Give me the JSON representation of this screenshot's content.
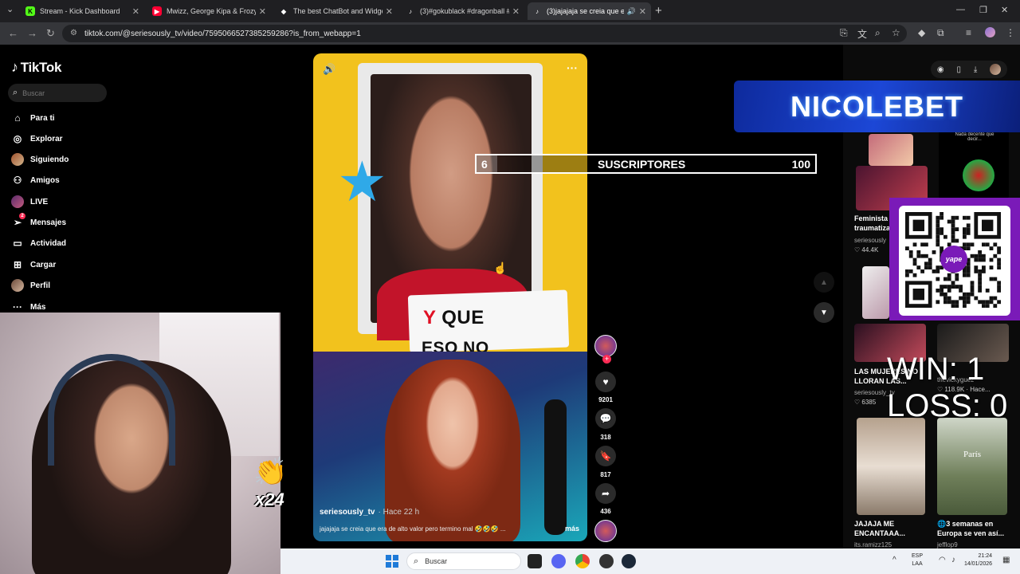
{
  "browser": {
    "tabs": [
      {
        "title": "Stream - Kick Dashboard",
        "favicon": "kick-icon",
        "color": "#53fc18",
        "active": false
      },
      {
        "title": "Mwizz, George Kipa & Frozy - D",
        "favicon": "youtube-icon",
        "color": "#ff0033",
        "active": false
      },
      {
        "title": "The best ChatBot and Widgets",
        "favicon": "botrix-icon",
        "color": "#ffffff",
        "active": false
      },
      {
        "title": "(3)#gokublack #dragonball #tra",
        "favicon": "tiktok-icon",
        "color": "#ffffff",
        "active": false
      },
      {
        "title": "(3)jajajaja se creia que era d",
        "favicon": "tiktok-icon",
        "color": "#ffffff",
        "active": true
      }
    ],
    "url": "tiktok.com/@seriesously_tv/video/7595066527385259286?is_from_webapp=1"
  },
  "tiktok": {
    "logo": "TikTok",
    "search_placeholder": "Buscar",
    "nav": [
      {
        "label": "Para ti",
        "icon": "home-icon"
      },
      {
        "label": "Explorar",
        "icon": "compass-icon"
      },
      {
        "label": "Siguiendo",
        "icon": "avatar"
      },
      {
        "label": "Amigos",
        "icon": "friends-icon"
      },
      {
        "label": "LIVE",
        "icon": "live-icon"
      },
      {
        "label": "Mensajes",
        "icon": "send-icon",
        "badge": "2"
      },
      {
        "label": "Actividad",
        "icon": "inbox-icon"
      },
      {
        "label": "Cargar",
        "icon": "upload-icon"
      },
      {
        "label": "Perfil",
        "icon": "avatar"
      },
      {
        "label": "Más",
        "icon": "more-icon"
      }
    ],
    "video": {
      "caption_line1_red": "Y",
      "caption_line1": "QUE",
      "caption_line2": "ESO NO",
      "author": "seriesously_tv",
      "time_ago": "· Hace 22 h",
      "description": "jajajaja se creia que era de alto valor pero termino mal 🤣🤣🤣 ...",
      "more": "más"
    },
    "actions": {
      "likes": "9201",
      "comments": "318",
      "saves": "817",
      "shares": "436"
    },
    "recommended": [
      {
        "title": "Feminista traumatiza...",
        "user": "seriesously",
        "stat": "♡ 44.4K"
      },
      {
        "title": "LAS MUJERES NO LLORAN LAS...",
        "user": "seriesously_tv",
        "stat": "♡ 6385"
      },
      {
        "title": "",
        "user": "thevickyguez",
        "stat": "♡ 118.9K · Hace..."
      },
      {
        "title": "JAJAJA ME ENCANTAAA...",
        "user": "its.ramizz125",
        "stat": ""
      },
      {
        "title": "🌐3 semanas en Europa se ven así...",
        "user": "jefflop9",
        "stat": ""
      }
    ],
    "thumb_text": "Nada decente que decir...",
    "thumb_paris": "París"
  },
  "overlay": {
    "sub_current": "6",
    "sub_label": "SUSCRIPTORES",
    "sub_goal": "100",
    "sub_progress": 0.06,
    "sponsor": "NICOLEBET",
    "qr_label": "yape",
    "win": "WIN: 1",
    "loss": "LOSS: 0",
    "multiplier": "x24"
  },
  "taskbar": {
    "search_placeholder": "Buscar",
    "lang_1": "ESP",
    "lang_2": "LAA",
    "time": "21:24",
    "date": "14/01/2026"
  },
  "colors": {
    "tiktok_red": "#fe2c55",
    "sponsor_blue": "#1c47d6",
    "yape_purple": "#7a1ab8"
  }
}
